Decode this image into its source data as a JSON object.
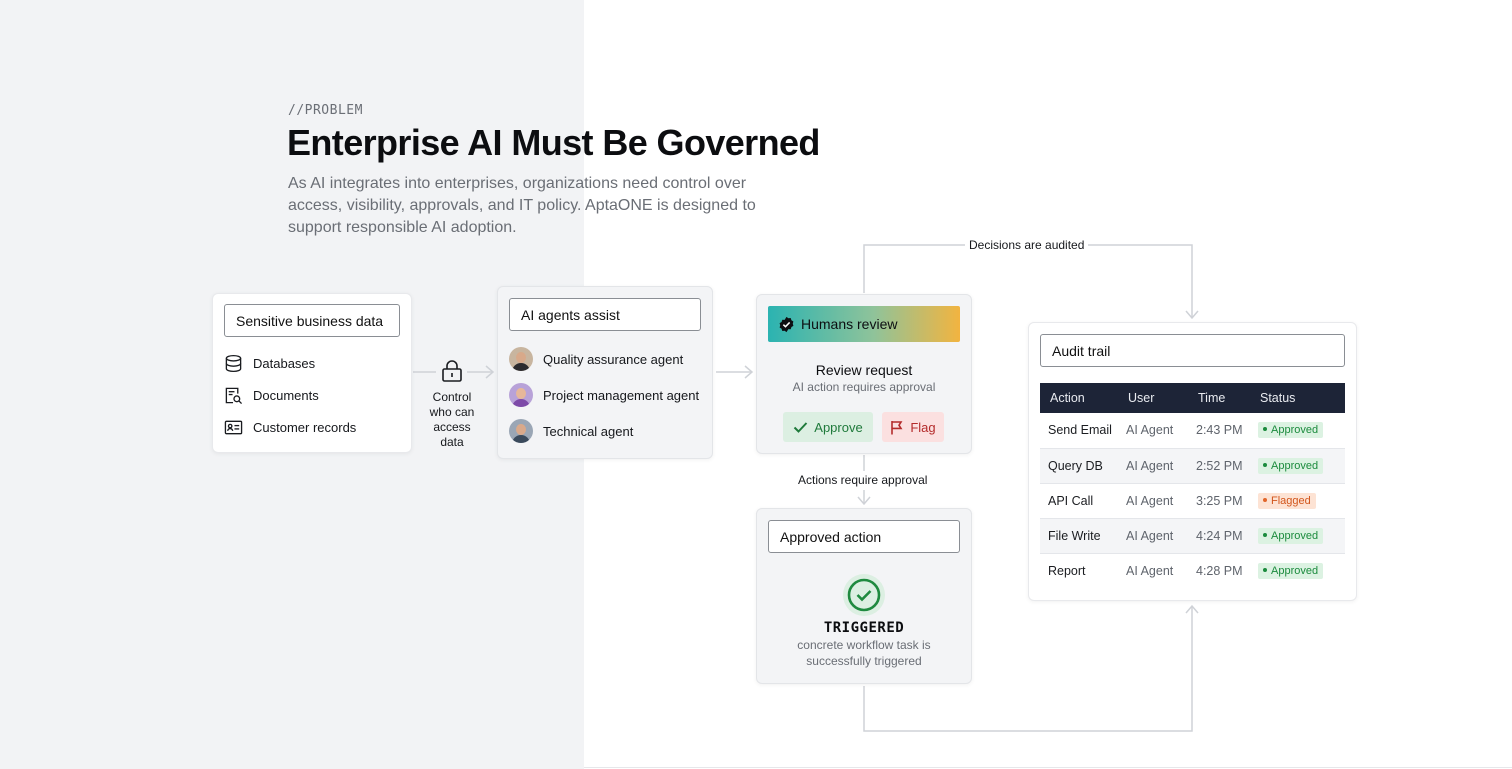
{
  "header": {
    "eyebrow": "//PROBLEM",
    "title": "Enterprise AI Must Be Governed",
    "lead": "As AI integrates into enterprises, organizations need control over access, visibility, approvals, and IT policy. AptaONE is designed to support responsible AI adoption."
  },
  "data_card": {
    "title": "Sensitive business data",
    "items": [
      {
        "label": "Databases",
        "icon": "database-icon"
      },
      {
        "label": "Documents",
        "icon": "document-search-icon"
      },
      {
        "label": "Customer records",
        "icon": "id-card-icon"
      }
    ]
  },
  "access_control": {
    "icon": "lock-icon",
    "label_lines": [
      "Control",
      "who can",
      "access",
      "data"
    ]
  },
  "agents_card": {
    "title": "AI agents assist",
    "agents": [
      {
        "label": "Quality assurance agent",
        "icon": "avatar-qa"
      },
      {
        "label": "Project management agent",
        "icon": "avatar-pm"
      },
      {
        "label": "Technical agent",
        "icon": "avatar-tech"
      }
    ]
  },
  "review_card": {
    "header": "Humans review",
    "title": "Review request",
    "subtitle": "AI action requires approval",
    "approve_label": "Approve",
    "flag_label": "Flag"
  },
  "approval_connector": "Actions require approval",
  "audit_connector": "Decisions are audited",
  "approved_card": {
    "title": "Approved action",
    "status": "TRIGGERED",
    "description": "concrete workflow task is successfully triggered"
  },
  "audit_card": {
    "title": "Audit trail",
    "columns": [
      "Action",
      "User",
      "Time",
      "Status"
    ],
    "rows": [
      {
        "action": "Send Email",
        "user": "AI Agent",
        "time": "2:43 PM",
        "status": "Approved"
      },
      {
        "action": "Query DB",
        "user": "AI Agent",
        "time": "2:52 PM",
        "status": "Approved"
      },
      {
        "action": "API Call",
        "user": "AI Agent",
        "time": "3:25 PM",
        "status": "Flagged"
      },
      {
        "action": "File Write",
        "user": "AI Agent",
        "time": "4:24 PM",
        "status": "Approved"
      },
      {
        "action": "Report",
        "user": "AI Agent",
        "time": "4:28 PM",
        "status": "Approved"
      }
    ]
  },
  "colors": {
    "page_left_bg": "#f2f3f5",
    "table_header_bg": "#1d2437",
    "approved_green": "#1b8b3d",
    "flagged_orange": "#d2561c",
    "gradient_start": "#2bb3b1",
    "gradient_end": "#f2b440"
  }
}
